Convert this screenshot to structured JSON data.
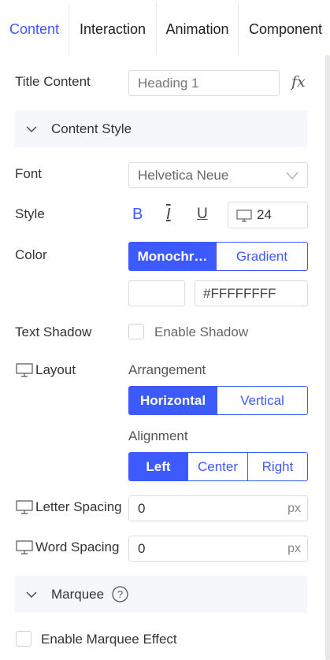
{
  "tabs": [
    {
      "label": "Content",
      "active": true
    },
    {
      "label": "Interaction",
      "active": false
    },
    {
      "label": "Animation",
      "active": false
    },
    {
      "label": "Component",
      "active": false
    }
  ],
  "title_content": {
    "label": "Title Content",
    "value": "Heading 1",
    "fx": "fx"
  },
  "content_style": {
    "title": "Content Style"
  },
  "font": {
    "label": "Font",
    "value": "Helvetica Neue"
  },
  "style": {
    "label": "Style",
    "bold": "B",
    "italic": "I",
    "underline": "U",
    "size": "24"
  },
  "color": {
    "label": "Color",
    "options": [
      "Monochr…",
      "Gradient"
    ],
    "selected": "Monochr…",
    "hex": "#FFFFFFFF",
    "swatch": "#FFFFFF"
  },
  "text_shadow": {
    "label": "Text Shadow",
    "checkbox_label": "Enable Shadow",
    "checked": false
  },
  "layout": {
    "label": "Layout",
    "arrangement_label": "Arrangement",
    "arrangement_options": [
      "Horizontal",
      "Vertical"
    ],
    "arrangement_selected": "Horizontal",
    "alignment_label": "Alignment",
    "alignment_options": [
      "Left",
      "Center",
      "Right"
    ],
    "alignment_selected": "Left"
  },
  "letter_spacing": {
    "label": "Letter Spacing",
    "value": "0",
    "unit": "px"
  },
  "word_spacing": {
    "label": "Word Spacing",
    "value": "0",
    "unit": "px"
  },
  "marquee": {
    "title": "Marquee",
    "help_icon": "question-circle-icon",
    "checkbox_label": "Enable Marquee Effect",
    "checked": false
  },
  "colors": {
    "accent": "#3D5AFE",
    "section_bg": "#F6F7FB",
    "border": "#D9DCE3"
  }
}
